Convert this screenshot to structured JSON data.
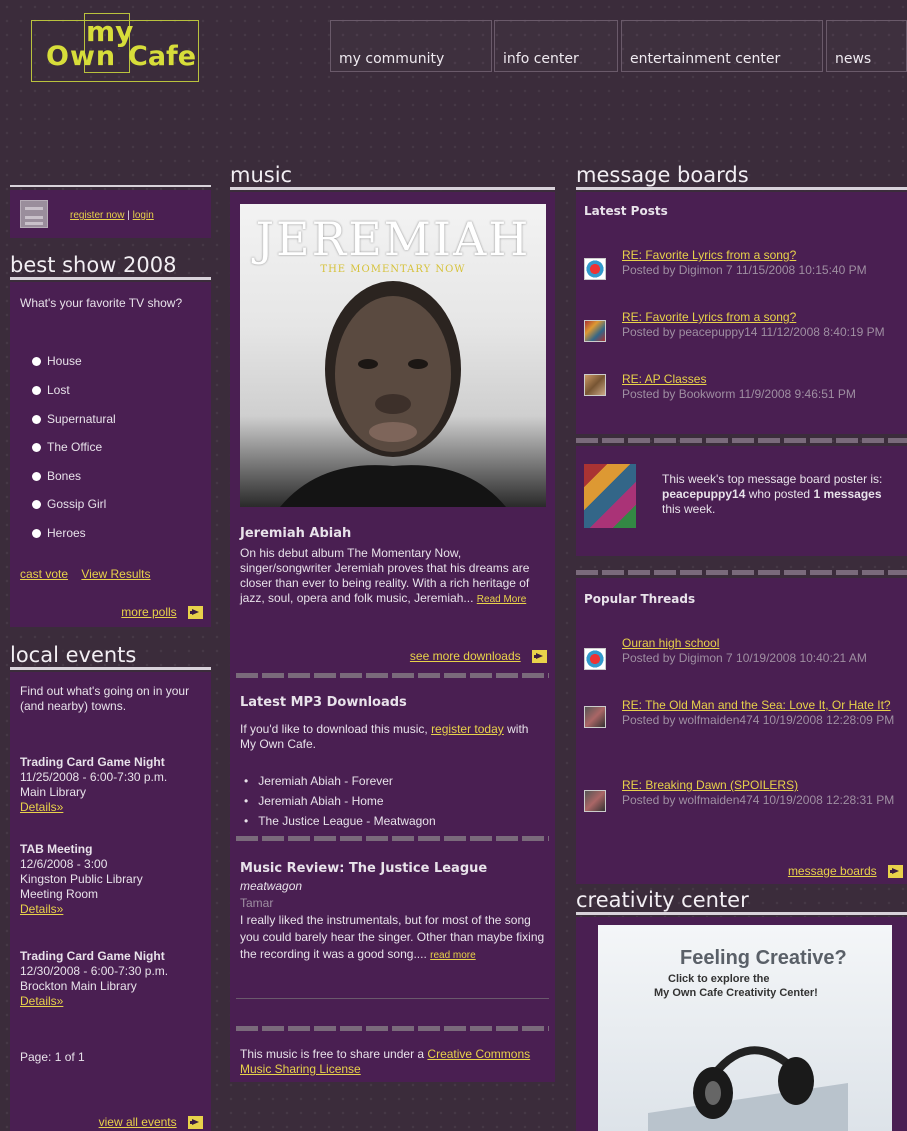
{
  "logo": {
    "my": "my",
    "own": "Own",
    "cafe": "Cafe"
  },
  "nav": [
    "my community",
    "info center",
    "entertainment center",
    "news"
  ],
  "login": {
    "register": "register now",
    "sep": "|",
    "login": "login"
  },
  "poll": {
    "heading": "best show 2008",
    "question": "What's your favorite TV show?",
    "options": [
      "House",
      "Lost",
      "Supernatural",
      "The Office",
      "Bones",
      "Gossip Girl",
      "Heroes"
    ],
    "cast_vote": "cast vote",
    "view_results": "View Results",
    "more_polls": "more polls"
  },
  "events": {
    "heading": "local events",
    "intro": "Find out what's going on in your (and nearby) towns.",
    "items": [
      {
        "title": "Trading Card Game Night",
        "lines": [
          "11/25/2008 - 6:00-7:30 p.m.",
          "Main Library"
        ],
        "details": "Details»"
      },
      {
        "title": "TAB Meeting",
        "lines": [
          "12/6/2008 - 3:00",
          "Kingston Public Library",
          "Meeting Room"
        ],
        "details": "Details»"
      },
      {
        "title": "Trading Card Game Night",
        "lines": [
          "12/30/2008 - 6:00-7:30 p.m.",
          "Brockton Main Library"
        ],
        "details": "Details»"
      }
    ],
    "page": "Page: 1 of 1",
    "view_all": "view all events"
  },
  "music": {
    "heading": "music",
    "album_title": "JEREMIAH",
    "album_subtitle": "THE MOMENTARY NOW",
    "artist": "Jeremiah Abiah",
    "blurb": "On his debut album The Momentary Now, singer/songwriter Jeremiah proves that his dreams are closer than ever to being reality. With a rich heritage of jazz, soul, opera and folk music, Jeremiah...",
    "read_more": "Read More",
    "see_more": "see more downloads",
    "mp3_heading": "Latest MP3 Downloads",
    "mp3_intro_a": "If you'd like to download this music,",
    "mp3_intro_link": "register today",
    "mp3_intro_b": "with My Own Cafe.",
    "tracks": [
      "Jeremiah Abiah - Forever",
      "Jeremiah Abiah - Home",
      "The Justice League - Meatwagon"
    ],
    "review_heading": "Music Review: The Justice League",
    "review_song": "meatwagon",
    "review_author": "Tamar",
    "review_text": "I really liked the instrumentals, but for most of the song you could barely hear the singer. Other than maybe fixing the recording it was a good song....",
    "review_read_more": "read more",
    "license_text": "This music is free to share under a",
    "license_link": "Creative Commons Music Sharing License"
  },
  "boards": {
    "heading": "message boards",
    "latest_heading": "Latest Posts",
    "latest": [
      {
        "title": "RE: Favorite Lyrics from a song?",
        "meta": "Posted by Digimon 7  11/15/2008 10:15:40 PM"
      },
      {
        "title": "RE: Favorite Lyrics from a song?",
        "meta": "Posted by peacepuppy14  11/12/2008 8:40:19 PM"
      },
      {
        "title": "RE: AP Classes",
        "meta": "Posted by Bookworm  11/9/2008 9:46:51 PM"
      }
    ],
    "top_a": "This week's top message board poster is:",
    "top_user": "peacepuppy14",
    "top_b": "who posted",
    "top_count": "1 messages",
    "top_c": "this week.",
    "popular_heading": "Popular Threads",
    "popular": [
      {
        "title": "Ouran high school",
        "meta": "Posted by Digimon 7  10/19/2008 10:40:21 AM"
      },
      {
        "title": "RE: The Old Man and the Sea: Love It, Or Hate It?",
        "meta": "Posted by wolfmaiden474  10/19/2008 12:28:09 PM"
      },
      {
        "title": "RE: Breaking Dawn (SPOILERS)",
        "meta": "Posted by wolfmaiden474  10/19/2008 12:28:31 PM"
      }
    ],
    "link": "message boards"
  },
  "creativity": {
    "heading": "creativity center",
    "banner_title": "Feeling Creative?",
    "banner_sub1": "Click to explore the",
    "banner_sub2": "My Own Cafe Creativity Center!"
  }
}
